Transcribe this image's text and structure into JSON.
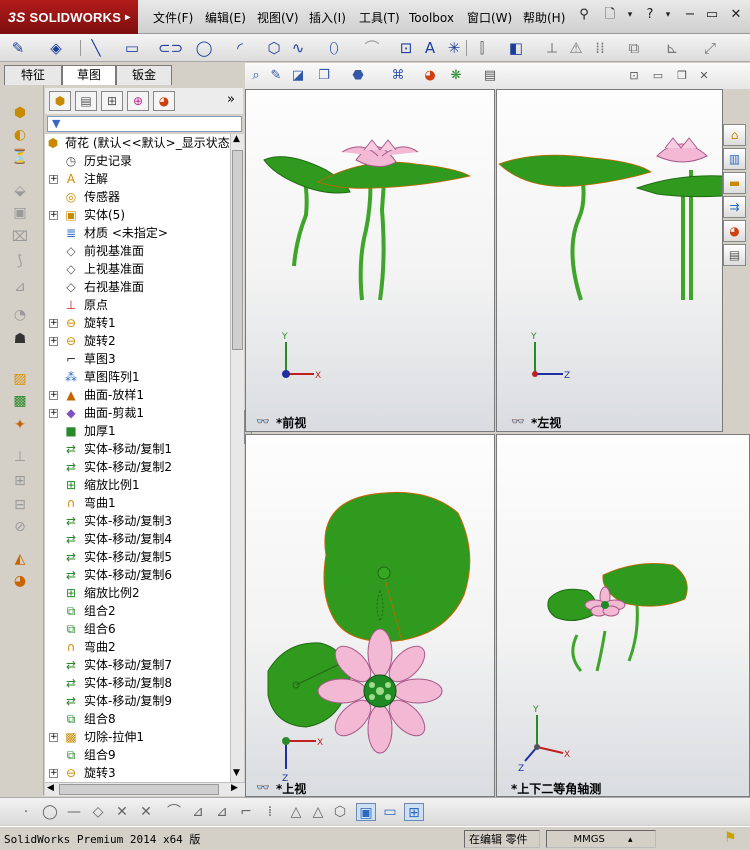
{
  "app": {
    "brand": "SOLIDWORKS",
    "brand_prefix": "3S"
  },
  "menu": [
    "文件(F)",
    "编辑(E)",
    "视图(V)",
    "插入(I)",
    "工具(T)",
    "Toolbox",
    "窗口(W)",
    "帮助(H)"
  ],
  "manager_tabs": [
    "特征",
    "草图",
    "钣金"
  ],
  "feature_manager": {
    "filter_placeholder": "",
    "root_label": "荷花",
    "root_config": "(默认<<默认>_显示状态",
    "items": [
      {
        "label": "历史记录",
        "icon": "history-icon",
        "expandable": false
      },
      {
        "label": "注解",
        "icon": "annotation-icon",
        "expandable": true
      },
      {
        "label": "传感器",
        "icon": "sensor-icon",
        "expandable": false
      },
      {
        "label": "实体(5)",
        "icon": "solid-bodies-icon",
        "expandable": true
      },
      {
        "label": "材质 <未指定>",
        "icon": "material-icon",
        "expandable": false
      },
      {
        "label": "前视基准面",
        "icon": "plane-icon",
        "expandable": false
      },
      {
        "label": "上视基准面",
        "icon": "plane-icon",
        "expandable": false
      },
      {
        "label": "右视基准面",
        "icon": "plane-icon",
        "expandable": false
      },
      {
        "label": "原点",
        "icon": "origin-icon",
        "expandable": false
      },
      {
        "label": "旋转1",
        "icon": "revolve-icon",
        "expandable": true
      },
      {
        "label": "旋转2",
        "icon": "revolve-icon",
        "expandable": true
      },
      {
        "label": "草图3",
        "icon": "sketch-icon",
        "expandable": false
      },
      {
        "label": "草图阵列1",
        "icon": "sketch-pattern-icon",
        "expandable": false
      },
      {
        "label": "曲面-放样1",
        "icon": "surface-loft-icon",
        "expandable": true
      },
      {
        "label": "曲面-剪裁1",
        "icon": "surface-trim-icon",
        "expandable": true
      },
      {
        "label": "加厚1",
        "icon": "thicken-icon",
        "expandable": false
      },
      {
        "label": "实体-移动/复制1",
        "icon": "move-copy-icon",
        "expandable": false
      },
      {
        "label": "实体-移动/复制2",
        "icon": "move-copy-icon",
        "expandable": false
      },
      {
        "label": "缩放比例1",
        "icon": "scale-icon",
        "expandable": false
      },
      {
        "label": "弯曲1",
        "icon": "flex-icon",
        "expandable": false
      },
      {
        "label": "实体-移动/复制3",
        "icon": "move-copy-icon",
        "expandable": false
      },
      {
        "label": "实体-移动/复制4",
        "icon": "move-copy-icon",
        "expandable": false
      },
      {
        "label": "实体-移动/复制5",
        "icon": "move-copy-icon",
        "expandable": false
      },
      {
        "label": "实体-移动/复制6",
        "icon": "move-copy-icon",
        "expandable": false
      },
      {
        "label": "缩放比例2",
        "icon": "scale-icon",
        "expandable": false
      },
      {
        "label": "组合2",
        "icon": "combine-icon",
        "expandable": false
      },
      {
        "label": "组合6",
        "icon": "combine-icon",
        "expandable": false
      },
      {
        "label": "弯曲2",
        "icon": "flex-icon",
        "expandable": false
      },
      {
        "label": "实体-移动/复制7",
        "icon": "move-copy-icon",
        "expandable": false
      },
      {
        "label": "实体-移动/复制8",
        "icon": "move-copy-icon",
        "expandable": false
      },
      {
        "label": "实体-移动/复制9",
        "icon": "move-copy-icon",
        "expandable": false
      },
      {
        "label": "组合8",
        "icon": "combine-icon",
        "expandable": false
      },
      {
        "label": "切除-拉伸1",
        "icon": "cut-extrude-icon",
        "expandable": true
      },
      {
        "label": "组合9",
        "icon": "combine-icon",
        "expandable": false
      },
      {
        "label": "旋转3",
        "icon": "revolve-icon",
        "expandable": true
      }
    ]
  },
  "viewports": {
    "front": {
      "label": "*前视",
      "axes": [
        "Y",
        "X"
      ]
    },
    "left": {
      "label": "*左视",
      "axes": [
        "Y",
        "Z"
      ]
    },
    "top": {
      "label": "*上视",
      "axes": [
        "X",
        "Z"
      ]
    },
    "iso": {
      "label": "*上下二等角轴测",
      "axes": [
        "Y",
        "X",
        "Z"
      ]
    }
  },
  "status": {
    "product": "SolidWorks Premium 2014 x64 版",
    "mode": "在编辑 零件",
    "units": "MMGS"
  },
  "colors": {
    "leaf": "#2f9a1e",
    "leaf_dark": "#1f6a12",
    "petal": "#f2b8d4",
    "stem": "#3ea52a",
    "brand": "#a31515"
  }
}
